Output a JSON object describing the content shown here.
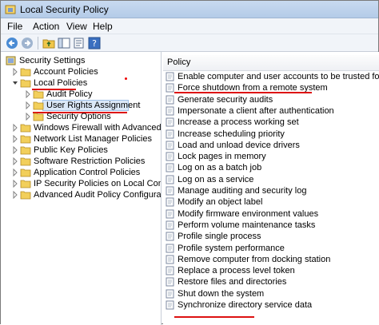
{
  "window": {
    "title": "Local Security Policy"
  },
  "menu": [
    "File",
    "Action",
    "View",
    "Help"
  ],
  "toolbar": {
    "icons": [
      "back-arrow-icon",
      "forward-arrow-icon",
      "up-folder-icon",
      "show-hide-tree-icon",
      "export-list-icon",
      "help-icon"
    ]
  },
  "tree": {
    "root": "Security Settings",
    "items": [
      {
        "label": "Account Policies",
        "level": 1,
        "expanded": false
      },
      {
        "label": "Local Policies",
        "level": 1,
        "expanded": true
      },
      {
        "label": "Audit Policy",
        "level": 2,
        "expanded": false
      },
      {
        "label": "User Rights Assignment",
        "level": 2,
        "expanded": false,
        "selected": true
      },
      {
        "label": "Security Options",
        "level": 2,
        "expanded": false
      },
      {
        "label": "Windows Firewall with Advanced Secu",
        "level": 1,
        "expanded": false
      },
      {
        "label": "Network List Manager Policies",
        "level": 1,
        "expanded": false
      },
      {
        "label": "Public Key Policies",
        "level": 1,
        "expanded": false
      },
      {
        "label": "Software Restriction Policies",
        "level": 1,
        "expanded": false
      },
      {
        "label": "Application Control Policies",
        "level": 1,
        "expanded": false
      },
      {
        "label": "IP Security Policies on Local Compute",
        "level": 1,
        "expanded": false
      },
      {
        "label": "Advanced Audit Policy Configuration",
        "level": 1,
        "expanded": false
      }
    ]
  },
  "list": {
    "column": "Policy",
    "rows": [
      "Enable computer and user accounts to be trusted for delega...",
      "Force shutdown from a remote system",
      "Generate security audits",
      "Impersonate a client after authentication",
      "Increase a process working set",
      "Increase scheduling priority",
      "Load and unload device drivers",
      "Lock pages in memory",
      "Log on as a batch job",
      "Log on as a service",
      "Manage auditing and security log",
      "Modify an object label",
      "Modify firmware environment values",
      "Perform volume maintenance tasks",
      "Profile single process",
      "Profile system performance",
      "Remove computer from docking station",
      "Replace a process level token",
      "Restore files and directories",
      "Shut down the system",
      "Synchronize directory service data"
    ]
  },
  "colors": {
    "annotation": "#d11111",
    "selection": "#dbe8f8"
  }
}
